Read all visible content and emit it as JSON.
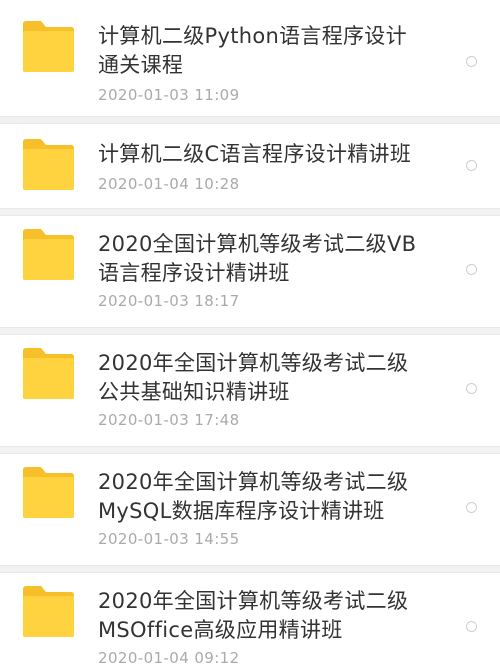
{
  "files": [
    {
      "title": "计算机二级Python语言程序设计\n通关课程",
      "time": "2020-01-03  11:09",
      "icon": "folder-icon"
    },
    {
      "title": "计算机二级C语言程序设计精讲班",
      "time": "2020-01-04  10:28",
      "icon": "folder-icon"
    },
    {
      "title": "2020全国计算机等级考试二级VB\n语言程序设计精讲班",
      "time": "2020-01-03  18:17",
      "icon": "folder-icon"
    },
    {
      "title": "2020年全国计算机等级考试二级\n公共基础知识精讲班",
      "time": "2020-01-03  17:48",
      "icon": "folder-icon"
    },
    {
      "title": "2020年全国计算机等级考试二级\nMySQL数据库程序设计精讲班",
      "time": "2020-01-03  14:55",
      "icon": "folder-icon"
    },
    {
      "title": "2020年全国计算机等级考试二级\nMSOffice高级应用精讲班",
      "time": "2020-01-04  09:12",
      "icon": "folder-icon"
    }
  ],
  "colors": {
    "folder": "#FFD23F",
    "folder_tab": "#F7C02B",
    "title": "#333333",
    "time": "#AAAAAA"
  }
}
